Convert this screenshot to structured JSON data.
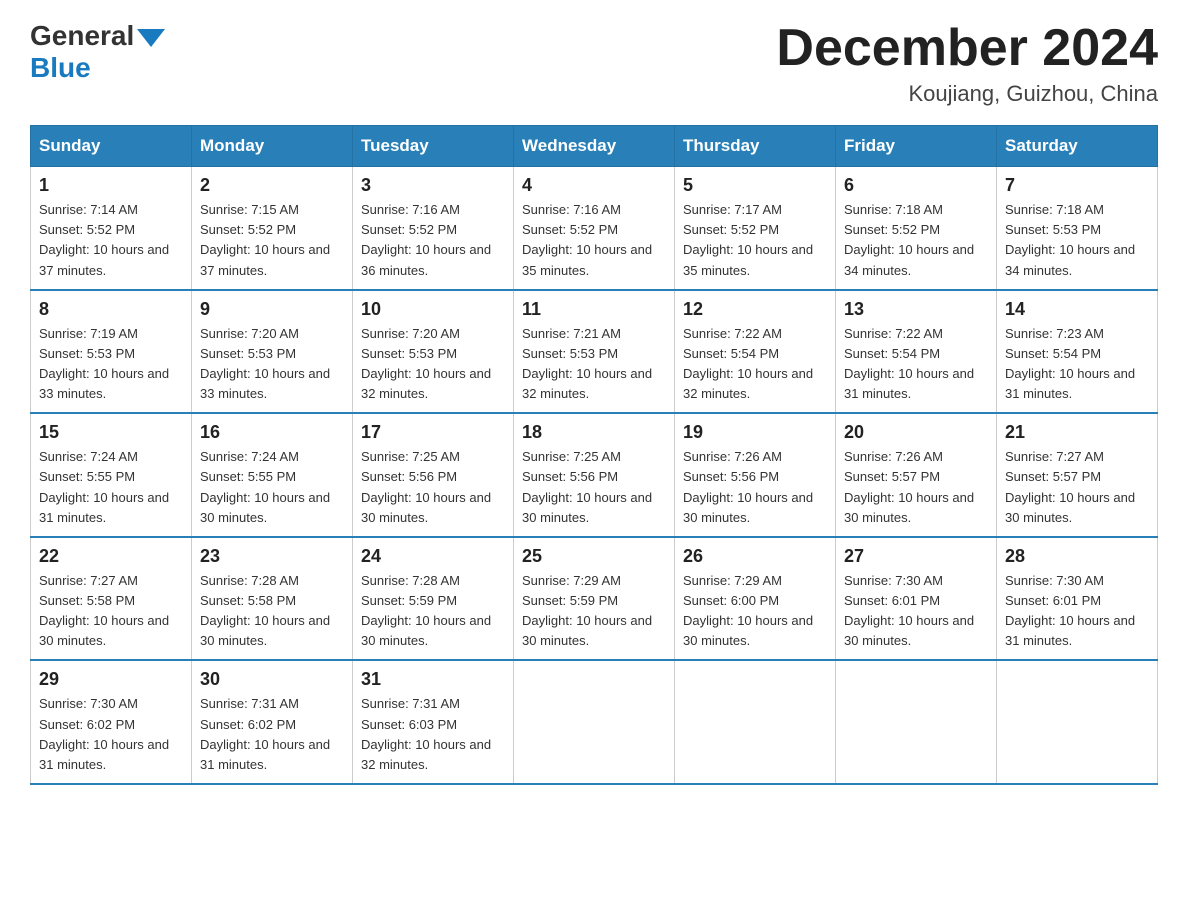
{
  "header": {
    "logo_general": "General",
    "logo_blue": "Blue",
    "month_title": "December 2024",
    "location": "Koujiang, Guizhou, China"
  },
  "days_of_week": [
    "Sunday",
    "Monday",
    "Tuesday",
    "Wednesday",
    "Thursday",
    "Friday",
    "Saturday"
  ],
  "weeks": [
    [
      {
        "num": "1",
        "sunrise": "7:14 AM",
        "sunset": "5:52 PM",
        "daylight": "10 hours and 37 minutes."
      },
      {
        "num": "2",
        "sunrise": "7:15 AM",
        "sunset": "5:52 PM",
        "daylight": "10 hours and 37 minutes."
      },
      {
        "num": "3",
        "sunrise": "7:16 AM",
        "sunset": "5:52 PM",
        "daylight": "10 hours and 36 minutes."
      },
      {
        "num": "4",
        "sunrise": "7:16 AM",
        "sunset": "5:52 PM",
        "daylight": "10 hours and 35 minutes."
      },
      {
        "num": "5",
        "sunrise": "7:17 AM",
        "sunset": "5:52 PM",
        "daylight": "10 hours and 35 minutes."
      },
      {
        "num": "6",
        "sunrise": "7:18 AM",
        "sunset": "5:52 PM",
        "daylight": "10 hours and 34 minutes."
      },
      {
        "num": "7",
        "sunrise": "7:18 AM",
        "sunset": "5:53 PM",
        "daylight": "10 hours and 34 minutes."
      }
    ],
    [
      {
        "num": "8",
        "sunrise": "7:19 AM",
        "sunset": "5:53 PM",
        "daylight": "10 hours and 33 minutes."
      },
      {
        "num": "9",
        "sunrise": "7:20 AM",
        "sunset": "5:53 PM",
        "daylight": "10 hours and 33 minutes."
      },
      {
        "num": "10",
        "sunrise": "7:20 AM",
        "sunset": "5:53 PM",
        "daylight": "10 hours and 32 minutes."
      },
      {
        "num": "11",
        "sunrise": "7:21 AM",
        "sunset": "5:53 PM",
        "daylight": "10 hours and 32 minutes."
      },
      {
        "num": "12",
        "sunrise": "7:22 AM",
        "sunset": "5:54 PM",
        "daylight": "10 hours and 32 minutes."
      },
      {
        "num": "13",
        "sunrise": "7:22 AM",
        "sunset": "5:54 PM",
        "daylight": "10 hours and 31 minutes."
      },
      {
        "num": "14",
        "sunrise": "7:23 AM",
        "sunset": "5:54 PM",
        "daylight": "10 hours and 31 minutes."
      }
    ],
    [
      {
        "num": "15",
        "sunrise": "7:24 AM",
        "sunset": "5:55 PM",
        "daylight": "10 hours and 31 minutes."
      },
      {
        "num": "16",
        "sunrise": "7:24 AM",
        "sunset": "5:55 PM",
        "daylight": "10 hours and 30 minutes."
      },
      {
        "num": "17",
        "sunrise": "7:25 AM",
        "sunset": "5:56 PM",
        "daylight": "10 hours and 30 minutes."
      },
      {
        "num": "18",
        "sunrise": "7:25 AM",
        "sunset": "5:56 PM",
        "daylight": "10 hours and 30 minutes."
      },
      {
        "num": "19",
        "sunrise": "7:26 AM",
        "sunset": "5:56 PM",
        "daylight": "10 hours and 30 minutes."
      },
      {
        "num": "20",
        "sunrise": "7:26 AM",
        "sunset": "5:57 PM",
        "daylight": "10 hours and 30 minutes."
      },
      {
        "num": "21",
        "sunrise": "7:27 AM",
        "sunset": "5:57 PM",
        "daylight": "10 hours and 30 minutes."
      }
    ],
    [
      {
        "num": "22",
        "sunrise": "7:27 AM",
        "sunset": "5:58 PM",
        "daylight": "10 hours and 30 minutes."
      },
      {
        "num": "23",
        "sunrise": "7:28 AM",
        "sunset": "5:58 PM",
        "daylight": "10 hours and 30 minutes."
      },
      {
        "num": "24",
        "sunrise": "7:28 AM",
        "sunset": "5:59 PM",
        "daylight": "10 hours and 30 minutes."
      },
      {
        "num": "25",
        "sunrise": "7:29 AM",
        "sunset": "5:59 PM",
        "daylight": "10 hours and 30 minutes."
      },
      {
        "num": "26",
        "sunrise": "7:29 AM",
        "sunset": "6:00 PM",
        "daylight": "10 hours and 30 minutes."
      },
      {
        "num": "27",
        "sunrise": "7:30 AM",
        "sunset": "6:01 PM",
        "daylight": "10 hours and 30 minutes."
      },
      {
        "num": "28",
        "sunrise": "7:30 AM",
        "sunset": "6:01 PM",
        "daylight": "10 hours and 31 minutes."
      }
    ],
    [
      {
        "num": "29",
        "sunrise": "7:30 AM",
        "sunset": "6:02 PM",
        "daylight": "10 hours and 31 minutes."
      },
      {
        "num": "30",
        "sunrise": "7:31 AM",
        "sunset": "6:02 PM",
        "daylight": "10 hours and 31 minutes."
      },
      {
        "num": "31",
        "sunrise": "7:31 AM",
        "sunset": "6:03 PM",
        "daylight": "10 hours and 32 minutes."
      },
      null,
      null,
      null,
      null
    ]
  ]
}
